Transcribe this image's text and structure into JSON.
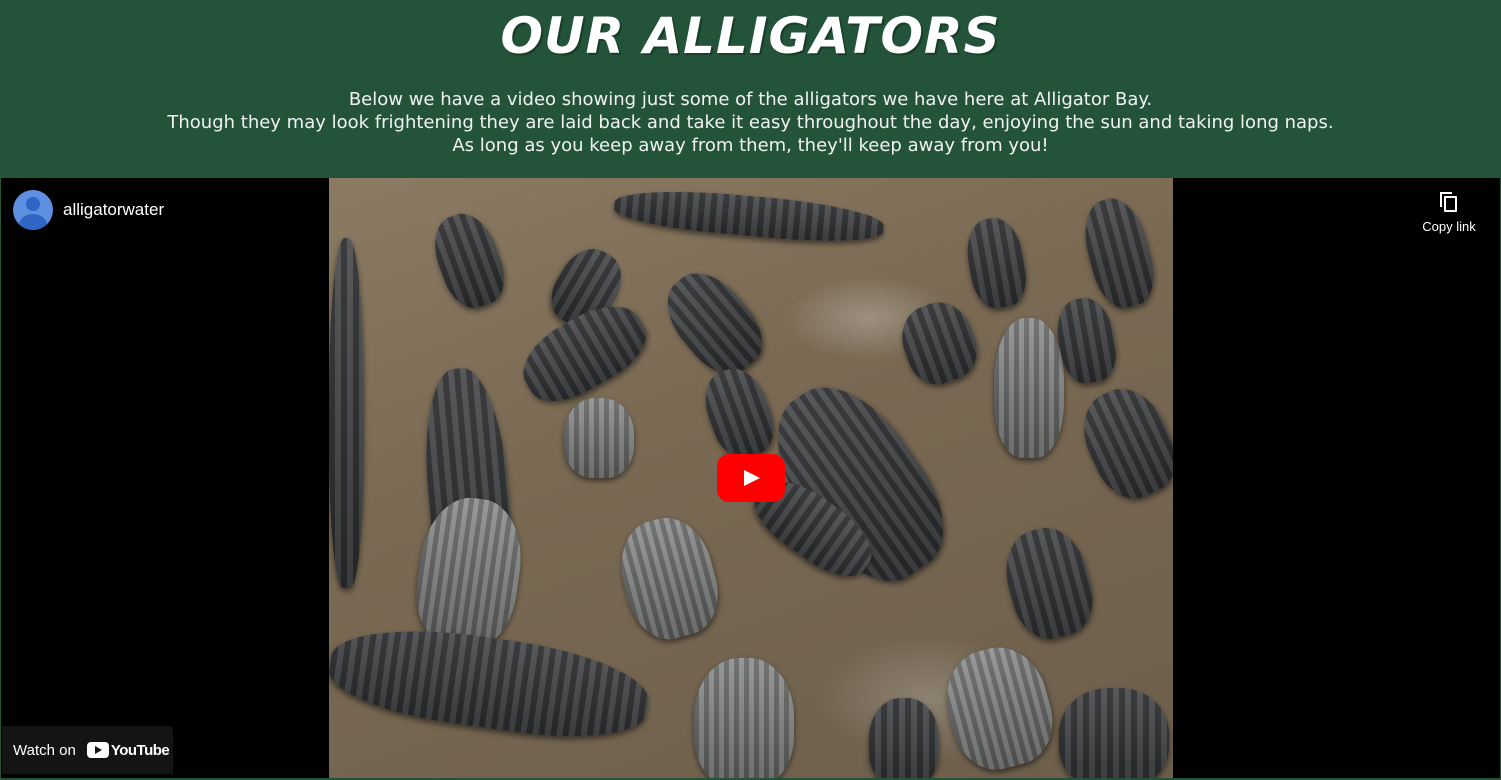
{
  "header": {
    "title": "Our Alligators",
    "intro_lines": [
      "Below we have a video showing just some of the alligators we have here at Alligator Bay.",
      "Though they may look frightening they are laid back and take it easy throughout the day, enjoying the sun and taking long naps.",
      "As long as you keep away from them, they'll keep away from you!"
    ]
  },
  "video": {
    "channel_name": "alligatorwater",
    "avatar_icon": "account-circle-icon",
    "copy_link_label": "Copy link",
    "copy_icon": "copy-icon",
    "play_icon": "youtube-play-icon",
    "watch_on_label": "Watch on",
    "youtube_wordmark": "YouTube"
  },
  "colors": {
    "header_bg": "#23543a",
    "player_bg": "#000000",
    "play_button": "#ff0000"
  }
}
